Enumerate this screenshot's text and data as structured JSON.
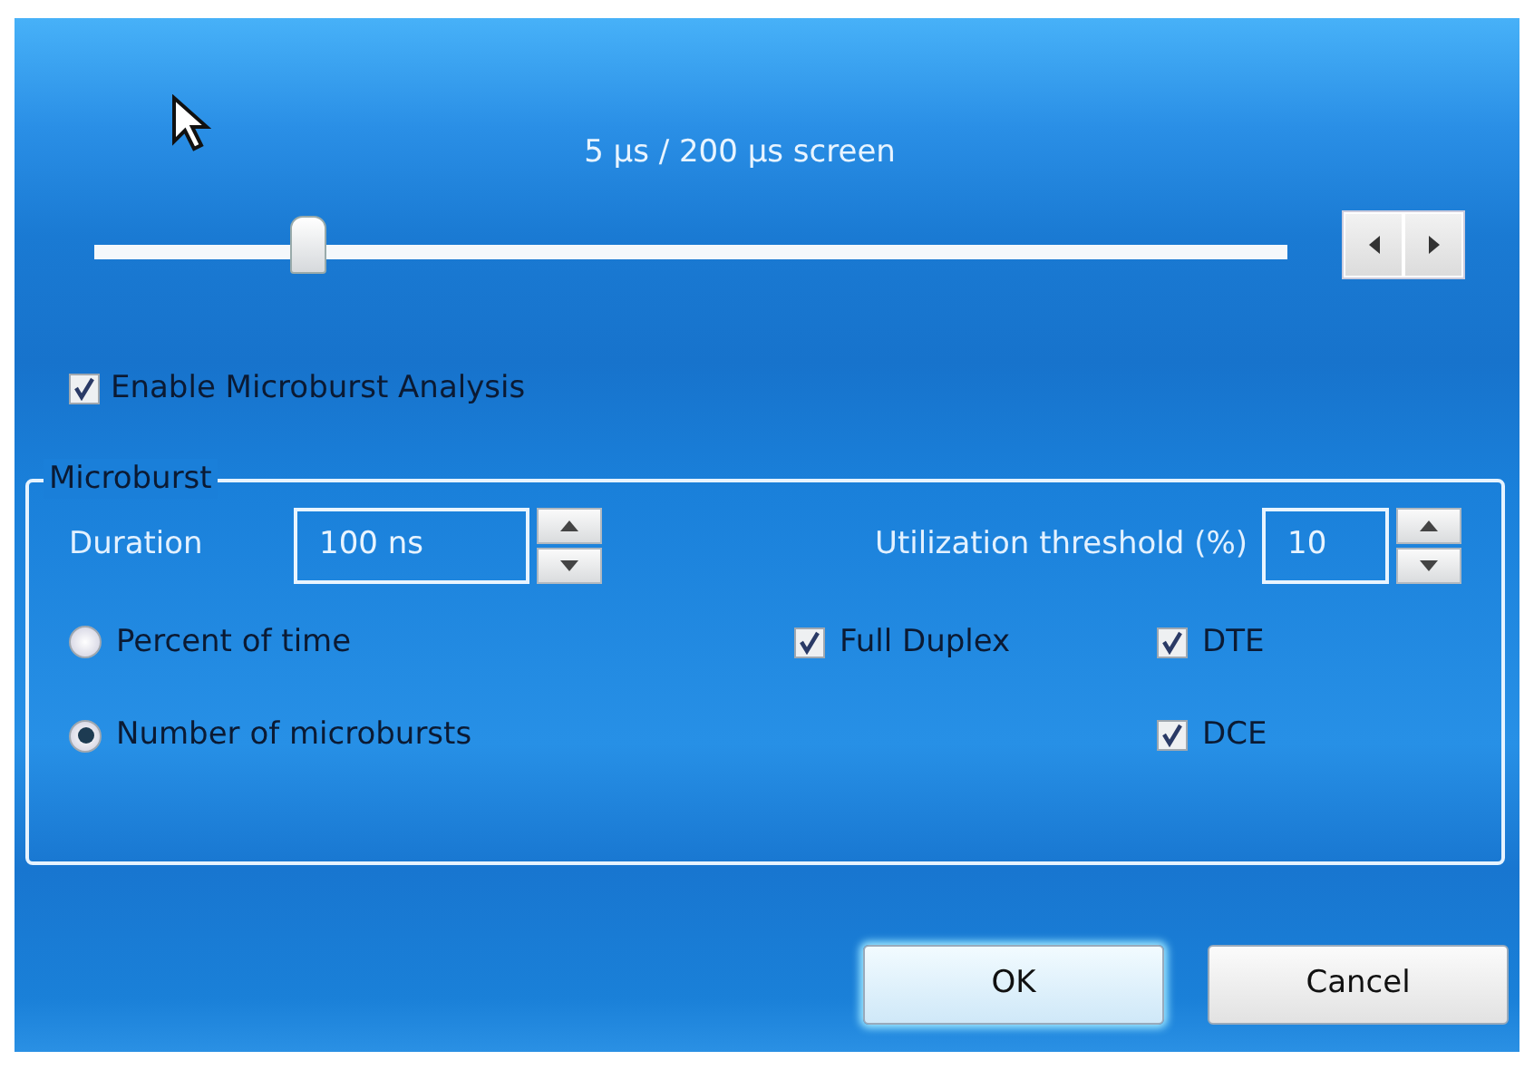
{
  "scale_label": "5 µs / 200 µs screen",
  "slider": {
    "level": 0.18
  },
  "enable": {
    "label": "Enable Microburst Analysis",
    "checked": true
  },
  "group": {
    "title": "Microburst",
    "duration": {
      "label": "Duration",
      "value": "100 ns"
    },
    "threshold": {
      "label": "Utilization threshold (%)",
      "value": "10"
    },
    "modes": [
      {
        "label": "Percent of time",
        "selected": false
      },
      {
        "label": "Number of microbursts",
        "selected": true
      }
    ],
    "options": [
      {
        "label": "Full Duplex",
        "checked": true
      },
      {
        "label": "DTE",
        "checked": true
      },
      {
        "label": "DCE",
        "checked": true
      }
    ]
  },
  "buttons": [
    {
      "label": "OK",
      "kind": "default"
    },
    {
      "label": "Cancel",
      "kind": "normal"
    }
  ]
}
